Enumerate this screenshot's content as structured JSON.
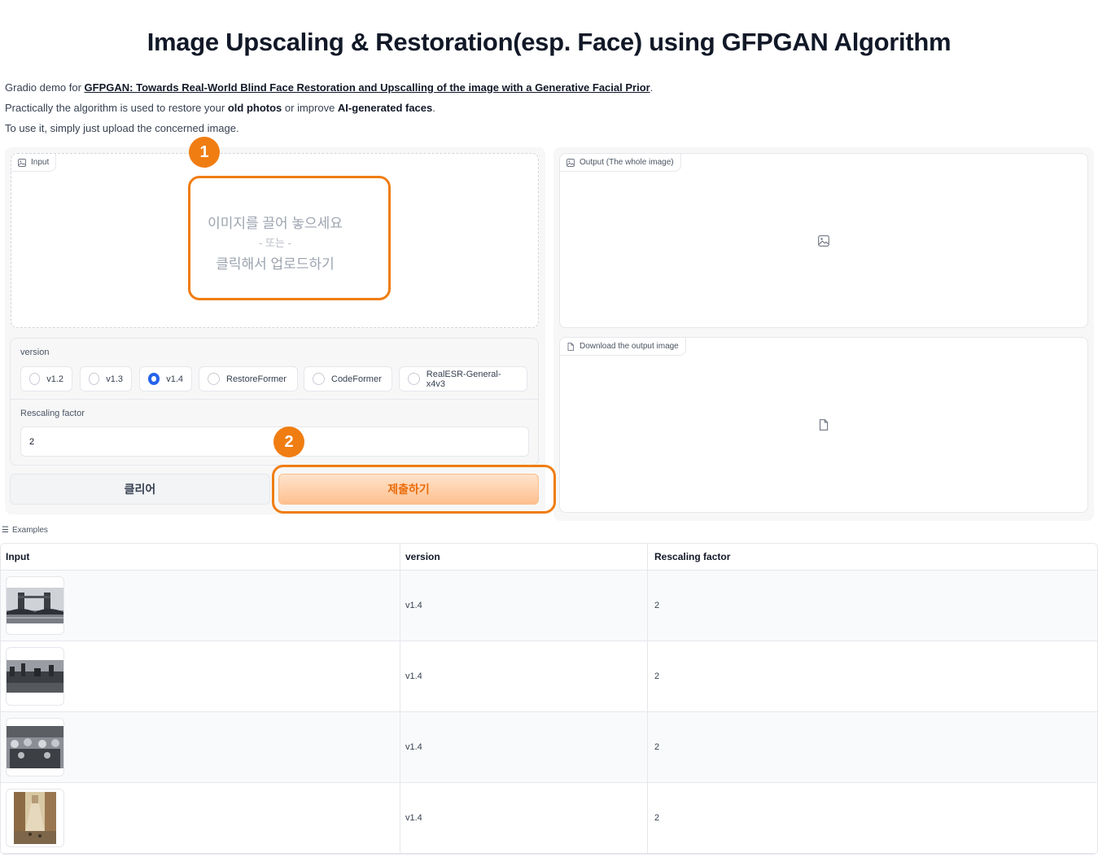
{
  "title": "Image Upscaling & Restoration(esp. Face) using GFPGAN Algorithm",
  "description": {
    "line1_prefix": "Gradio demo for ",
    "line1_link": "GFPGAN: Towards Real-World Blind Face Restoration and Upscalling of the image with a Generative Facial Prior",
    "line1_suffix": ".",
    "line2_prefix": "Practically the algorithm is used to restore your ",
    "line2_bold1": "old photos",
    "line2_mid": " or improve ",
    "line2_bold2": "AI-generated faces",
    "line2_suffix": ".",
    "line3": "To use it, simply just upload the concerned image."
  },
  "input_panel": {
    "label": "Input",
    "drop_line1": "이미지를 끌어 놓으세요",
    "drop_line2": "- 또는 -",
    "drop_line3": "클릭해서 업로드하기"
  },
  "version": {
    "label": "version",
    "options": [
      "v1.2",
      "v1.3",
      "v1.4",
      "RestoreFormer",
      "CodeFormer",
      "RealESR-General-x4v3"
    ],
    "selected": "v1.4"
  },
  "rescaling": {
    "label": "Rescaling factor",
    "value": "2"
  },
  "buttons": {
    "clear": "클리어",
    "submit": "제출하기"
  },
  "output_panel": {
    "label": "Output (The whole image)"
  },
  "download_panel": {
    "label": "Download the output image"
  },
  "annotations": {
    "badge1": "1",
    "badge2": "2",
    "color": "#f07d12"
  },
  "examples": {
    "label": "Examples",
    "headers": [
      "Input",
      "version",
      "Rescaling factor"
    ],
    "rows": [
      {
        "version": "v1.4",
        "factor": "2"
      },
      {
        "version": "v1.4",
        "factor": "2"
      },
      {
        "version": "v1.4",
        "factor": "2"
      },
      {
        "version": "v1.4",
        "factor": "2"
      }
    ]
  },
  "colors": {
    "accent": "#f07d12",
    "radio_selected": "#2563eb",
    "submit_text": "#ea6c0a"
  }
}
